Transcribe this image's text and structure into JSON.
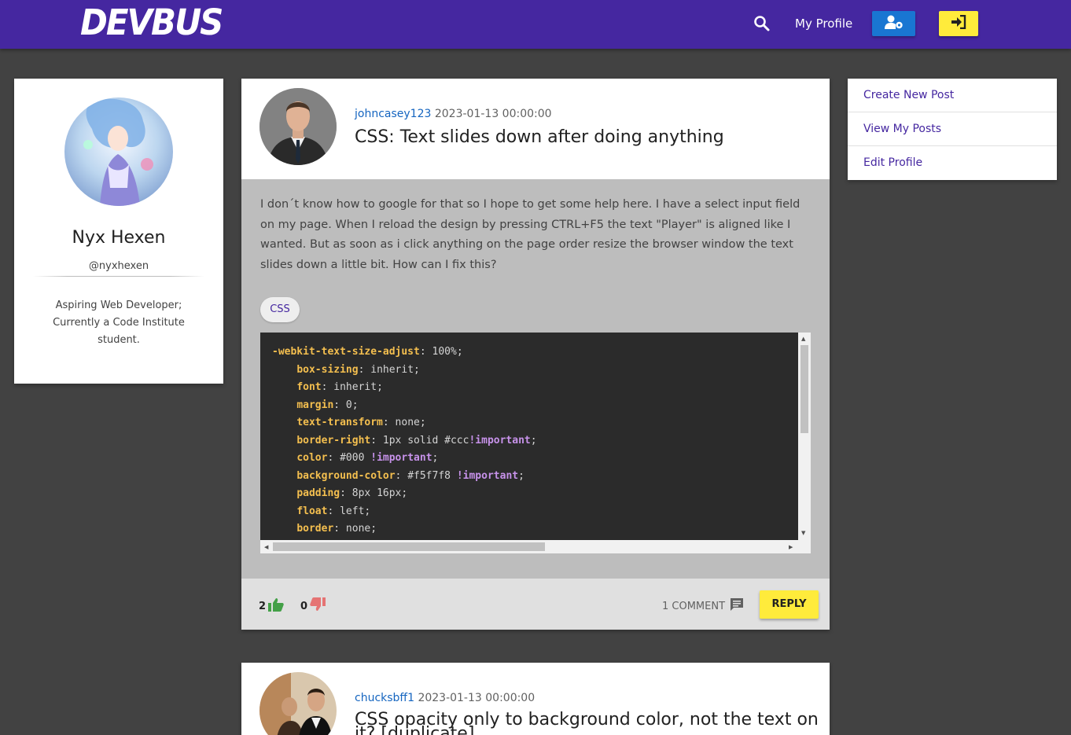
{
  "navbar": {
    "brand": "DEVBUS",
    "profile_label": "My Profile",
    "icons": {
      "search": "search-icon",
      "profile_settings": "user-cog-icon",
      "login": "sign-in-icon"
    },
    "colors": {
      "bar": "#4527a0",
      "blue_button": "#1976d2",
      "yellow_button": "#ffeb3b"
    }
  },
  "profile": {
    "name": "Nyx Hexen",
    "handle": "@nyxhexen",
    "bio": "Aspiring Web Developer; Currently a Code Institute student."
  },
  "menu": {
    "items": [
      {
        "label": "Create New Post"
      },
      {
        "label": "View My Posts"
      },
      {
        "label": "Edit Profile"
      }
    ]
  },
  "posts": [
    {
      "author": "johncasey123",
      "date": "2023-01-13 00:00:00",
      "title": "CSS: Text slides down after doing anything",
      "body": "I don´t know how to google for that so I hope to get some help here. I have a select input field on my page. When I reload the design by pressing CTRL+F5 the text \"Player\" is aligned like I wanted. But as soon as i click anything on the page order resize the browser window the text slides down a little bit. How can I fix this?",
      "tag": "CSS",
      "code": [
        {
          "prop": "-webkit-text-size-adjust",
          "value": "100%",
          "important": "",
          "indent": false
        },
        {
          "prop": "box-sizing",
          "value": "inherit",
          "important": "",
          "indent": true
        },
        {
          "prop": "font",
          "value": "inherit",
          "important": "",
          "indent": true
        },
        {
          "prop": "margin",
          "value": "0",
          "important": "",
          "indent": true
        },
        {
          "prop": "text-transform",
          "value": "none",
          "important": "",
          "indent": true
        },
        {
          "prop": "border-right",
          "value": "1px solid #ccc",
          "important": "!important",
          "indent": true
        },
        {
          "prop": "color",
          "value": "#000 ",
          "important": "!important",
          "indent": true
        },
        {
          "prop": "background-color",
          "value": "#f5f7f8 ",
          "important": "!important",
          "indent": true
        },
        {
          "prop": "padding",
          "value": "8px 16px",
          "important": "",
          "indent": true
        },
        {
          "prop": "float",
          "value": "left",
          "important": "",
          "indent": true
        },
        {
          "prop": "border",
          "value": "none",
          "important": "",
          "indent": true
        }
      ],
      "likes": "2",
      "dislikes": "0",
      "comments_label": "1 COMMENT",
      "reply_label": "REPLY"
    },
    {
      "author": "chucksbff1",
      "date": "2023-01-13 00:00:00",
      "title": "CSS opacity only to background color, not the text on it? [duplicate]"
    }
  ]
}
